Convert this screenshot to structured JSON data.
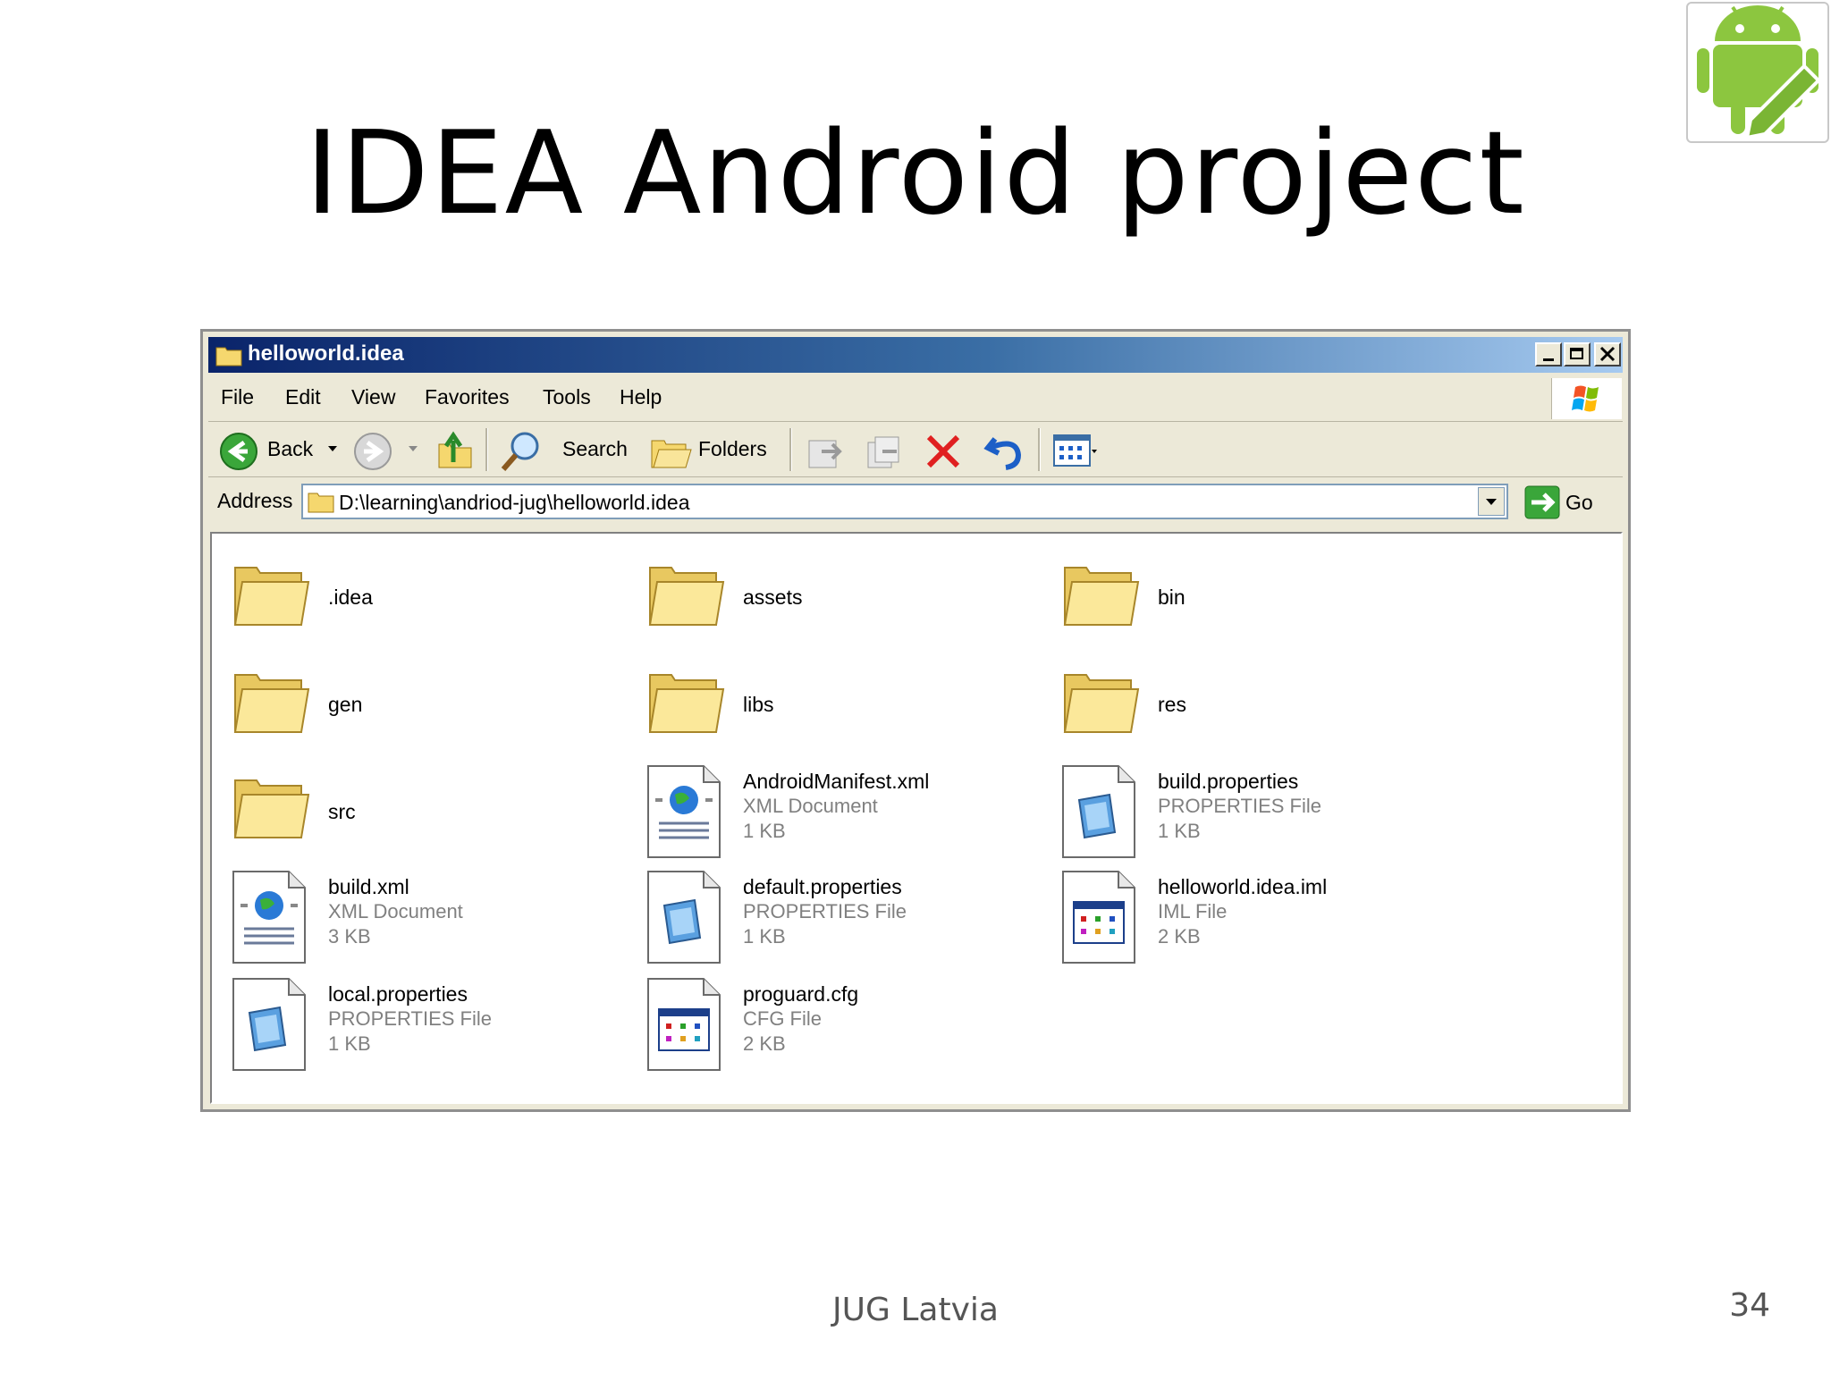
{
  "slide": {
    "title": "IDEA Android project",
    "footer": "JUG Latvia",
    "page_number": "34"
  },
  "window": {
    "title": "helloworld.idea",
    "menu": [
      "File",
      "Edit",
      "View",
      "Favorites",
      "Tools",
      "Help"
    ],
    "toolbar": {
      "back_label": "Back",
      "search_label": "Search",
      "folders_label": "Folders"
    },
    "address": {
      "label": "Address",
      "value": "D:\\learning\\andriod-jug\\helloworld.idea",
      "go_label": "Go"
    }
  },
  "files": [
    {
      "name": ".idea",
      "kind": "folder"
    },
    {
      "name": "assets",
      "kind": "folder"
    },
    {
      "name": "bin",
      "kind": "folder"
    },
    {
      "name": "gen",
      "kind": "folder"
    },
    {
      "name": "libs",
      "kind": "folder"
    },
    {
      "name": "res",
      "kind": "folder"
    },
    {
      "name": "src",
      "kind": "folder"
    },
    {
      "name": "AndroidManifest.xml",
      "kind": "xml",
      "type": "XML Document",
      "size": "1 KB"
    },
    {
      "name": "build.properties",
      "kind": "properties",
      "type": "PROPERTIES File",
      "size": "1 KB"
    },
    {
      "name": "build.xml",
      "kind": "xml",
      "type": "XML Document",
      "size": "3 KB"
    },
    {
      "name": "default.properties",
      "kind": "properties",
      "type": "PROPERTIES File",
      "size": "1 KB"
    },
    {
      "name": "helloworld.idea.iml",
      "kind": "app",
      "type": "IML File",
      "size": "2 KB"
    },
    {
      "name": "local.properties",
      "kind": "properties",
      "type": "PROPERTIES File",
      "size": "1 KB"
    },
    {
      "name": "proguard.cfg",
      "kind": "app",
      "type": "CFG File",
      "size": "2 KB"
    }
  ]
}
